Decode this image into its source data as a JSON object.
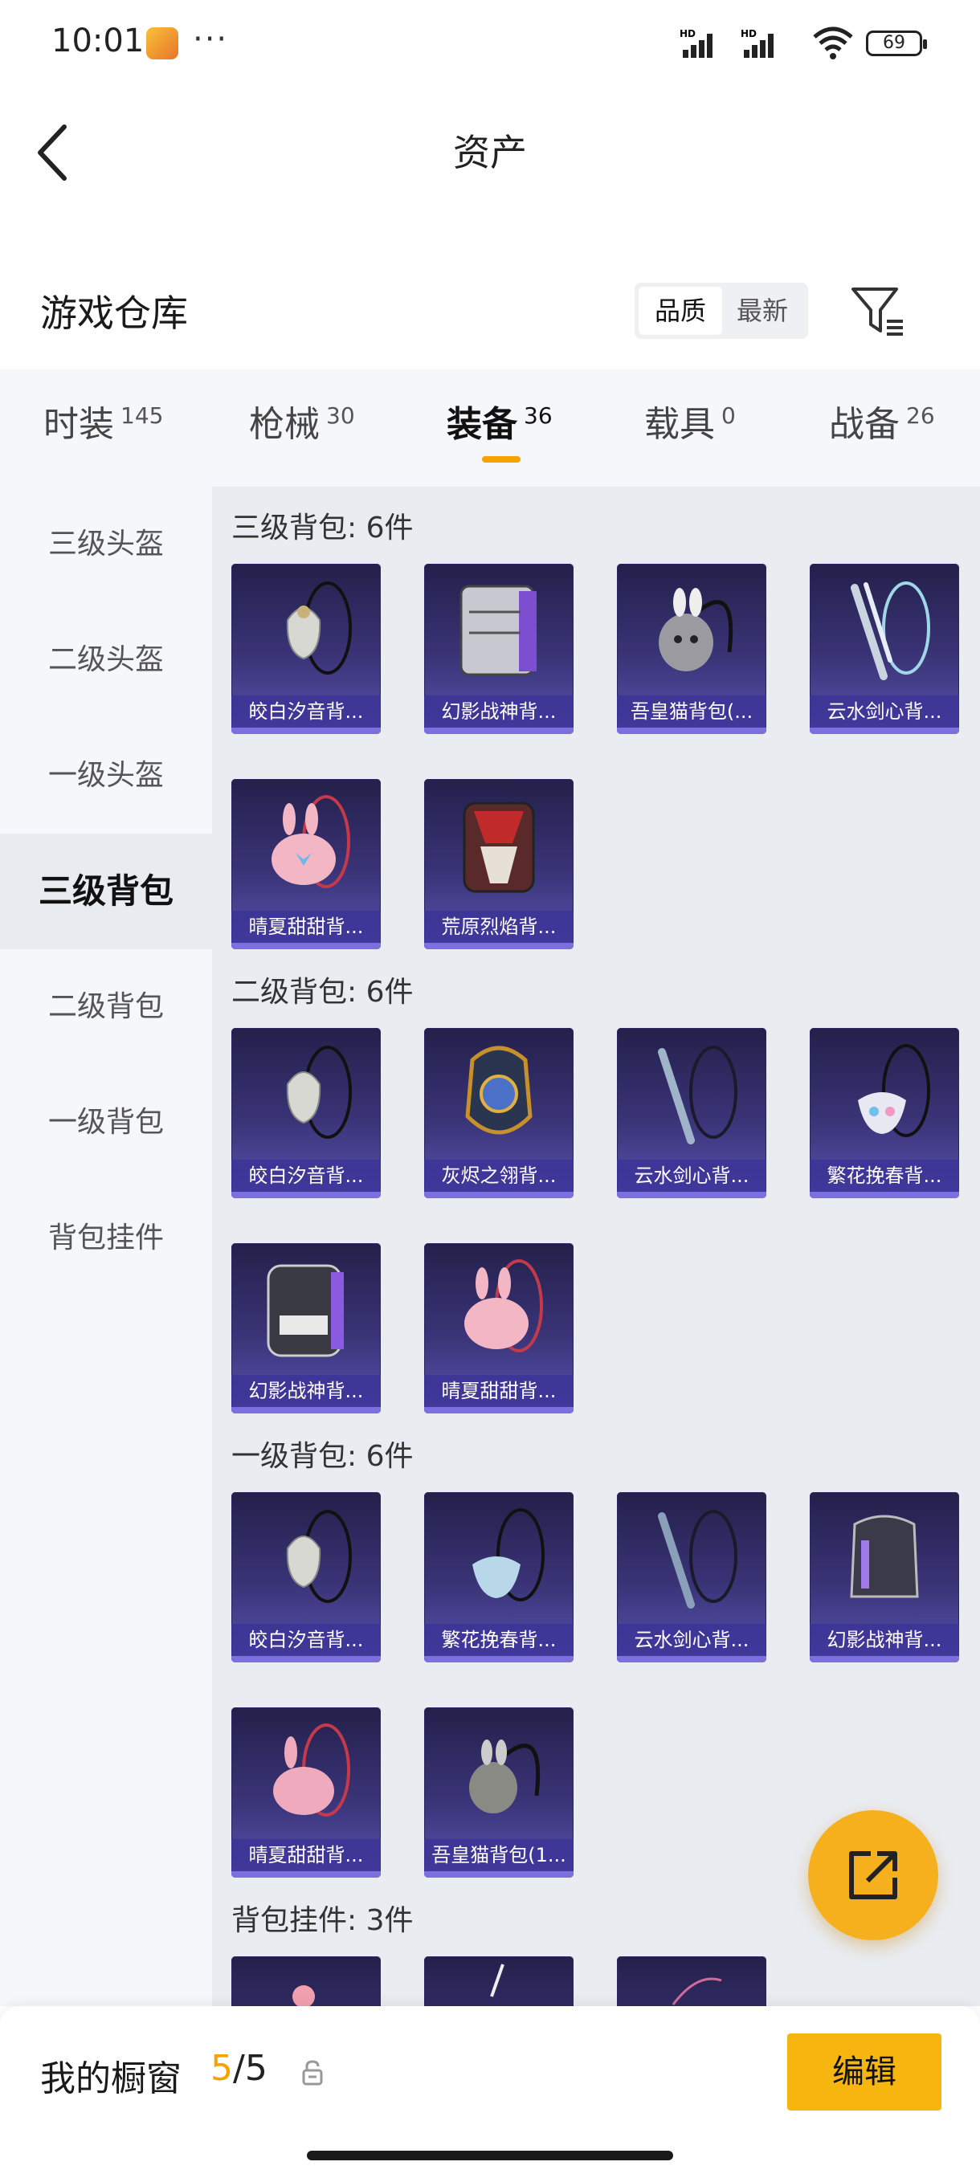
{
  "status_bar": {
    "time": "10:01",
    "more": "···",
    "battery": "69"
  },
  "header": {
    "title": "资产"
  },
  "section": {
    "title": "游戏仓库",
    "sort_quality": "品质",
    "sort_newest": "最新"
  },
  "tabs": [
    {
      "label": "时装",
      "count": "145"
    },
    {
      "label": "枪械",
      "count": "30"
    },
    {
      "label": "装备",
      "count": "36"
    },
    {
      "label": "载具",
      "count": "0"
    },
    {
      "label": "战备",
      "count": "26"
    }
  ],
  "sidebar": {
    "items": [
      "三级头盔",
      "二级头盔",
      "一级头盔",
      "三级背包",
      "二级背包",
      "一级背包",
      "背包挂件"
    ]
  },
  "groups": [
    {
      "title": "三级背包: 6件",
      "items": [
        "皎白汐音背...",
        "幻影战神背...",
        "吾皇猫背包(...",
        "云水剑心背...",
        "晴夏甜甜背...",
        "荒原烈焰背..."
      ]
    },
    {
      "title": "二级背包: 6件",
      "items": [
        "皎白汐音背...",
        "灰烬之翎背...",
        "云水剑心背...",
        "繁花挽春背...",
        "幻影战神背...",
        "晴夏甜甜背..."
      ]
    },
    {
      "title": "一级背包: 6件",
      "items": [
        "皎白汐音背...",
        "繁花挽春背...",
        "云水剑心背...",
        "幻影战神背...",
        "晴夏甜甜背...",
        "吾皇猫背包(1..."
      ]
    },
    {
      "title": "背包挂件: 3件",
      "items": [
        "",
        "",
        ""
      ]
    }
  ],
  "bottom_bar": {
    "label": "我的橱窗",
    "current": "5",
    "total": "/5",
    "edit": "编辑"
  },
  "colors": {
    "accent": "#f5a300",
    "card_top": "#24204a",
    "card_bottom": "#5a53b2"
  }
}
